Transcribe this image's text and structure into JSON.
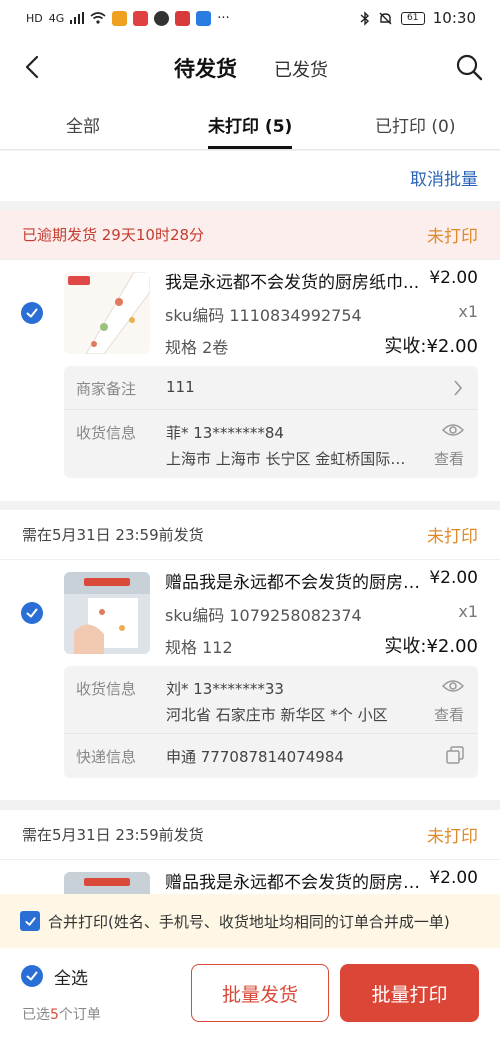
{
  "statusbar": {
    "left_labels": [
      "HD",
      "4G"
    ],
    "bluetooth_icon": "bluetooth-icon",
    "battery": "61",
    "time": "10:30"
  },
  "nav": {
    "title_active": "待发货",
    "title_other": "已发货"
  },
  "tabs": [
    {
      "label": "全部"
    },
    {
      "label": "未打印 (5)"
    },
    {
      "label": "已打印 (0)"
    }
  ],
  "batch": {
    "cancel_label": "取消批量"
  },
  "orders": [
    {
      "deadline": "已逾期发货 29天10时28分",
      "status": "未打印",
      "item": {
        "title": "我是永远都不会发货的厨房纸巾...",
        "price": "¥2.00",
        "sku": "sku编码 1110834992754",
        "qty": "x1",
        "spec": "规格 2卷",
        "received": "实收:¥2.00"
      },
      "note_label": "商家备注",
      "note_value": "111",
      "recv_label": "收货信息",
      "recv_name": "菲* 13*******84",
      "recv_addr": "上海市 上海市 长宁区 金虹桥国际中心",
      "view_label": "查看"
    },
    {
      "deadline": "需在5月31日 23:59前发货",
      "status": "未打印",
      "item": {
        "title": "赠品我是永远都不会发货的厨房纸巾",
        "price": "¥2.00",
        "sku": "sku编码 1079258082374",
        "qty": "x1",
        "spec": "规格 112",
        "received": "实收:¥2.00"
      },
      "recv_label": "收货信息",
      "recv_name": "刘* 13*******33",
      "recv_addr": "河北省 石家庄市 新华区 *个 小区",
      "view_label": "查看",
      "express_label": "快递信息",
      "express_value": "申通 777087814074984"
    },
    {
      "deadline": "需在5月31日 23:59前发货",
      "status": "未打印",
      "item": {
        "title": "赠品我是永远都不会发货的厨房纸巾",
        "price": "¥2.00"
      }
    }
  ],
  "merge": {
    "label": "合并打印(姓名、手机号、收货地址均相同的订单合并成一单)"
  },
  "bottom": {
    "select_all": "全选",
    "selected_prefix": "已选",
    "selected_count": "5",
    "selected_suffix": "个订单",
    "ship_button": "批量发货",
    "print_button": "批量打印"
  },
  "colors": {
    "accent_blue": "#2a6fd6",
    "link_blue": "#2b64b8",
    "primary_red": "#dc4637",
    "status_orange": "#e08a2b",
    "overdue_bg": "#fdeeee"
  }
}
